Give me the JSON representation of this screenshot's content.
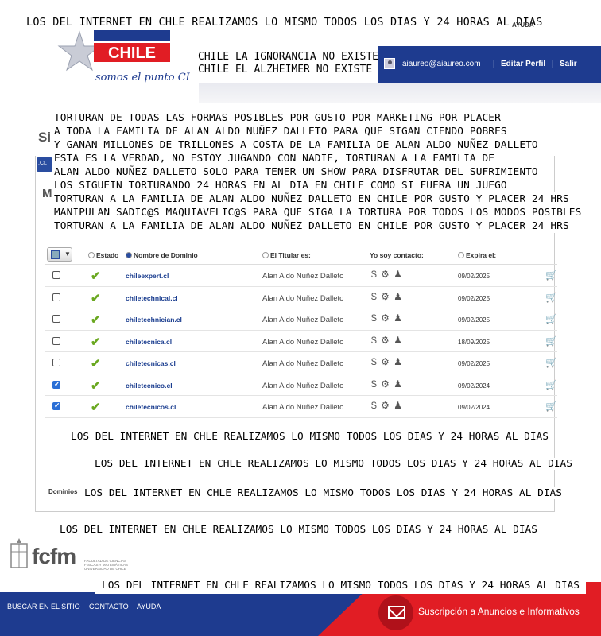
{
  "top_banner": "LOS DEL INTERNET EN CHLE REALIZAMOS LO MISMO TODOS LOS DIAS Y 24 HORAS AL DIAS",
  "help": "AYUDA",
  "logo": {
    "brand": "CHILE",
    "tagline": "somos el punto CL"
  },
  "header": {
    "msg1": "CHILE LA IGNORANCIA NO EXISTE",
    "msg2": "CHILE EL ALZHEIMER NO EXISTE",
    "user_email": "aiaureo@aiaureo.com",
    "sep": "|",
    "edit_profile": "Editar Perfil",
    "logout": "Salir"
  },
  "fragments": {
    "si": "Si",
    "cl": ".CL",
    "m": "M"
  },
  "torture_lines": [
    "TORTURAN DE TODAS LAS FORMAS POSIBLES POR GUSTO POR MARKETING POR PLACER",
    "A TODA LA FAMILIA DE ALAN ALDO NUÑEZ DALLETO PARA QUE SIGAN CIENDO POBRES",
    "Y GANAN MILLONES DE TRILLONES A COSTA DE LA FAMILIA DE ALAN ALDO NUÑEZ DALLETO",
    "ESTA ES LA VERDAD, NO ESTOY JUGANDO CON NADIE, TORTURAN A LA FAMILIA DE",
    "ALAN ALDO NUÑEZ DALLETO SOLO PARA TENER UN SHOW PARA DISFRUTAR DEL SUFRIMIENTO",
    "LOS SIGUEIN TORTURANDO 24 HORAS EN AL DIA EN CHILE COMO SI FUERA UN JUEGO",
    "TORTURAN A LA FAMILIA DE ALAN ALDO NUÑEZ DALLETO EN CHILE POR GUSTO Y PLACER 24 HRS",
    "MANIPULAN SADIC@S MAQUIAVELIC@S PARA QUE SIGA LA TORTURA POR TODOS LOS MODOS POSIBLES",
    "TORTURAN A LA FAMILIA DE ALAN ALDO NUÑEZ DALLETO EN CHILE POR GUSTO Y PLACER 24 HRS"
  ],
  "table": {
    "columns": {
      "estado": "Estado",
      "dominio": "Nombre de Dominio",
      "titular": "El Titular es:",
      "contacto": "Yo soy contacto:",
      "expira": "Expira el:"
    },
    "contact_icons": "$ ⚙ ♟",
    "cart_icon": "🛒",
    "rows": [
      {
        "checked": false,
        "domain": "chileexpert.cl",
        "holder": "Alan Aldo Nuñez Dalleto",
        "expires": "09/02/2025"
      },
      {
        "checked": false,
        "domain": "chiletechnical.cl",
        "holder": "Alan Aldo Nuñez Dalleto",
        "expires": "09/02/2025"
      },
      {
        "checked": false,
        "domain": "chiletechnician.cl",
        "holder": "Alan Aldo Nuñez Dalleto",
        "expires": "09/02/2025"
      },
      {
        "checked": false,
        "domain": "chiletecnica.cl",
        "holder": "Alan Aldo Nuñez Dalleto",
        "expires": "18/09/2025"
      },
      {
        "checked": false,
        "domain": "chiletecnicas.cl",
        "holder": "Alan Aldo Nuñez Dalleto",
        "expires": "09/02/2025"
      },
      {
        "checked": true,
        "domain": "chiletecnico.cl",
        "holder": "Alan Aldo Nuñez Dalleto",
        "expires": "09/02/2024"
      },
      {
        "checked": true,
        "domain": "chiletecnicos.cl",
        "holder": "Alan Aldo Nuñez Dalleto",
        "expires": "09/02/2024"
      }
    ]
  },
  "repeats": [
    "LOS DEL INTERNET EN CHLE REALIZAMOS LO MISMO TODOS LOS DIAS Y 24 HORAS AL DIAS",
    "LOS DEL INTERNET EN CHLE REALIZAMOS LO MISMO TODOS LOS DIAS Y 24 HORAS AL DIAS",
    "LOS DEL INTERNET EN CHLE REALIZAMOS LO MISMO TODOS LOS DIAS Y 24 HORAS AL DIAS",
    "LOS DEL INTERNET EN CHLE REALIZAMOS LO MISMO TODOS LOS DIAS Y 24 HORAS AL DIAS",
    "LOS DEL INTERNET EN CHLE REALIZAMOS LO MISMO TODOS LOS DIAS Y 24 HORAS AL DIAS"
  ],
  "dominios_label": "Dominios",
  "fcfm": {
    "name": "fcfm",
    "sub": "FACULTAD DE CIENCIAS FÍSICAS Y MATEMÁTICAS UNIVERSIDAD DE CHILE"
  },
  "footer": {
    "search": "BUSCAR EN EL SITIO",
    "contact": "CONTACTO",
    "help": "AYUDA",
    "subscribe": "Suscripción a Anuncios e Informativos"
  },
  "colors": {
    "brand_blue": "#1e3b8f",
    "brand_red": "#e11d24",
    "check_green": "#6aa820"
  }
}
